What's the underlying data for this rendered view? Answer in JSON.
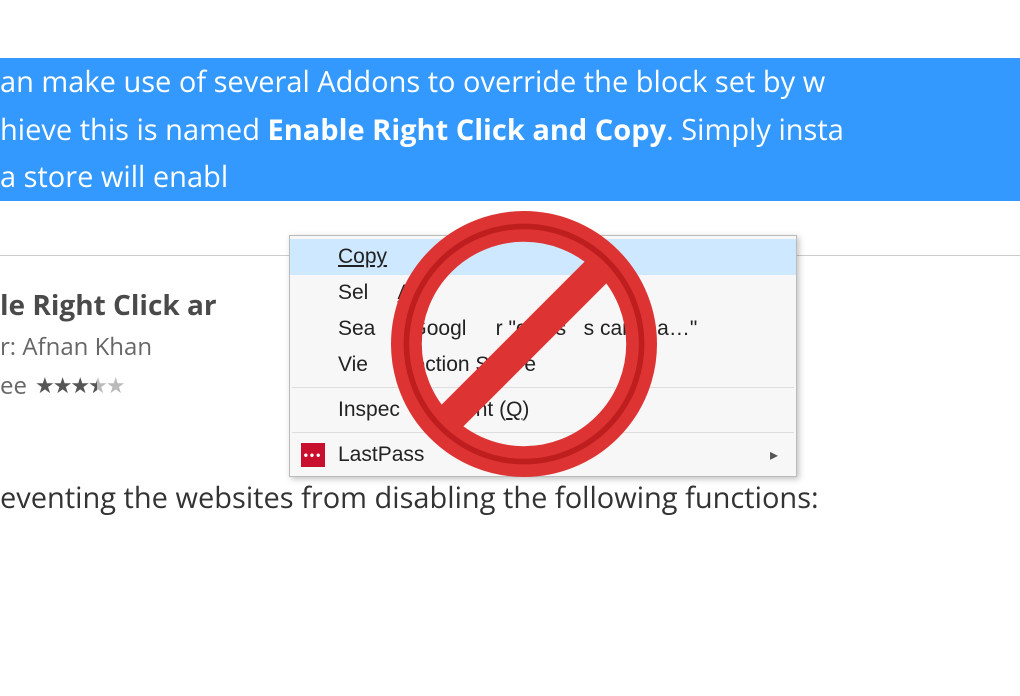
{
  "article": {
    "highlighted": {
      "line1_pre": "an make use of several Addons to override the block set by w",
      "line2_pre": "hieve this is named ",
      "line2_bold": "Enable Right Click and Copy",
      "line2_post": ". Simply insta",
      "line3": "a store will enabl"
    },
    "footer": "eventing the websites from disabling the following functions:"
  },
  "extension": {
    "title": "le Right Click ar",
    "author_label": "r: Afnan Khan",
    "free_label": "ee",
    "rating_stars": 3.5
  },
  "context_menu": {
    "copy": "Copy",
    "select_all_pre": "Sel",
    "select_all_mid": "A",
    "search_pre": "Sea",
    "search_mid": "h Googl",
    "search_post": "r \"ox us",
    "search_end": "s can ma…\"",
    "view_source_pre": "Vie",
    "view_source_mid": "election S",
    "view_source_post": "e",
    "inspect_pre": "Inspec",
    "inspect_mid": "ment (",
    "inspect_post": ")",
    "inspect_key": "Q",
    "lastpass": "LastPass"
  },
  "icons": {
    "lastpass": "•••"
  }
}
